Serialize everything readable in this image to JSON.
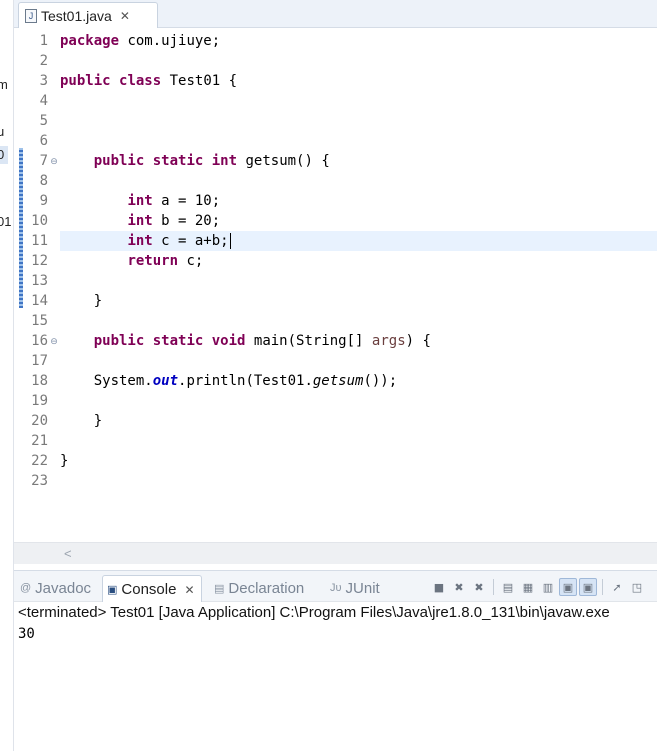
{
  "editor_tab": {
    "icon": "java-file-icon",
    "title": "Test01.java",
    "close": "✕"
  },
  "left_strip": {
    "fragments": [
      "m",
      "u",
      "0",
      "01"
    ]
  },
  "code_lines": [
    {
      "n": "1",
      "parts": [
        {
          "t": "package",
          "c": "kw"
        },
        {
          "t": " com.ujiuye;"
        }
      ]
    },
    {
      "n": "2",
      "parts": []
    },
    {
      "n": "3",
      "parts": [
        {
          "t": "public",
          "c": "kw"
        },
        {
          "t": " "
        },
        {
          "t": "class",
          "c": "kw"
        },
        {
          "t": " Test01 {"
        }
      ]
    },
    {
      "n": "4",
      "parts": []
    },
    {
      "n": "5",
      "parts": []
    },
    {
      "n": "6",
      "parts": []
    },
    {
      "n": "7",
      "fold": true,
      "parts": [
        {
          "t": "    "
        },
        {
          "t": "public",
          "c": "kw"
        },
        {
          "t": " "
        },
        {
          "t": "static",
          "c": "kw"
        },
        {
          "t": " "
        },
        {
          "t": "int",
          "c": "kw"
        },
        {
          "t": " getsum() {"
        }
      ]
    },
    {
      "n": "8",
      "parts": []
    },
    {
      "n": "9",
      "parts": [
        {
          "t": "        "
        },
        {
          "t": "int",
          "c": "kw"
        },
        {
          "t": " a = 10;"
        }
      ]
    },
    {
      "n": "10",
      "parts": [
        {
          "t": "        "
        },
        {
          "t": "int",
          "c": "kw"
        },
        {
          "t": " b = 20;"
        }
      ]
    },
    {
      "n": "11",
      "current": true,
      "parts": [
        {
          "t": "        "
        },
        {
          "t": "int",
          "c": "kw"
        },
        {
          "t": " c = a+b;"
        }
      ]
    },
    {
      "n": "12",
      "parts": [
        {
          "t": "        "
        },
        {
          "t": "return",
          "c": "kw"
        },
        {
          "t": " c;"
        }
      ]
    },
    {
      "n": "13",
      "parts": []
    },
    {
      "n": "14",
      "parts": [
        {
          "t": "    }"
        }
      ]
    },
    {
      "n": "15",
      "parts": []
    },
    {
      "n": "16",
      "fold": true,
      "parts": [
        {
          "t": "    "
        },
        {
          "t": "public",
          "c": "kw"
        },
        {
          "t": " "
        },
        {
          "t": "static",
          "c": "kw"
        },
        {
          "t": " "
        },
        {
          "t": "void",
          "c": "kw"
        },
        {
          "t": " main(String[] "
        },
        {
          "t": "args",
          "c": "prm"
        },
        {
          "t": ") {"
        }
      ]
    },
    {
      "n": "17",
      "parts": []
    },
    {
      "n": "18",
      "parts": [
        {
          "t": "    System."
        },
        {
          "t": "out",
          "c": "fld"
        },
        {
          "t": ".println(Test01."
        },
        {
          "t": "getsum",
          "c": "ital"
        },
        {
          "t": "());"
        }
      ]
    },
    {
      "n": "19",
      "parts": []
    },
    {
      "n": "20",
      "parts": [
        {
          "t": "    }"
        }
      ]
    },
    {
      "n": "21",
      "parts": []
    },
    {
      "n": "22",
      "parts": [
        {
          "t": "}"
        }
      ]
    },
    {
      "n": "23",
      "parts": []
    }
  ],
  "scroll": {
    "left_arrow": "<"
  },
  "console_tabs": [
    {
      "name": "javadoc",
      "icon": "@",
      "label": "Javadoc"
    },
    {
      "name": "console",
      "icon": "▣",
      "label": "Console",
      "active": true,
      "close": "✕"
    },
    {
      "name": "declaration",
      "icon": "▤",
      "label": "Declaration"
    },
    {
      "name": "junit",
      "icon": "Jυ",
      "label": "JUnit"
    }
  ],
  "console_toolbar": [
    {
      "name": "terminate-icon",
      "g": "■"
    },
    {
      "name": "remove-launch-icon",
      "g": "✖"
    },
    {
      "name": "remove-all-launches-icon",
      "g": "✖"
    },
    {
      "sep": true
    },
    {
      "name": "clear-console-icon",
      "g": "▤"
    },
    {
      "name": "scroll-lock-icon",
      "g": "▦"
    },
    {
      "name": "word-wrap-icon",
      "g": "▥"
    },
    {
      "name": "show-on-stdout-icon",
      "g": "▣",
      "pressed": true
    },
    {
      "name": "show-on-stderr-icon",
      "g": "▣",
      "pressed": true
    },
    {
      "sep": true
    },
    {
      "name": "pin-console-icon",
      "g": "➚"
    },
    {
      "name": "display-console-icon",
      "g": "◳"
    }
  ],
  "console": {
    "status": "<terminated> Test01 [Java Application] C:\\Program Files\\Java\\jre1.8.0_131\\bin\\javaw.exe",
    "output": "30"
  }
}
